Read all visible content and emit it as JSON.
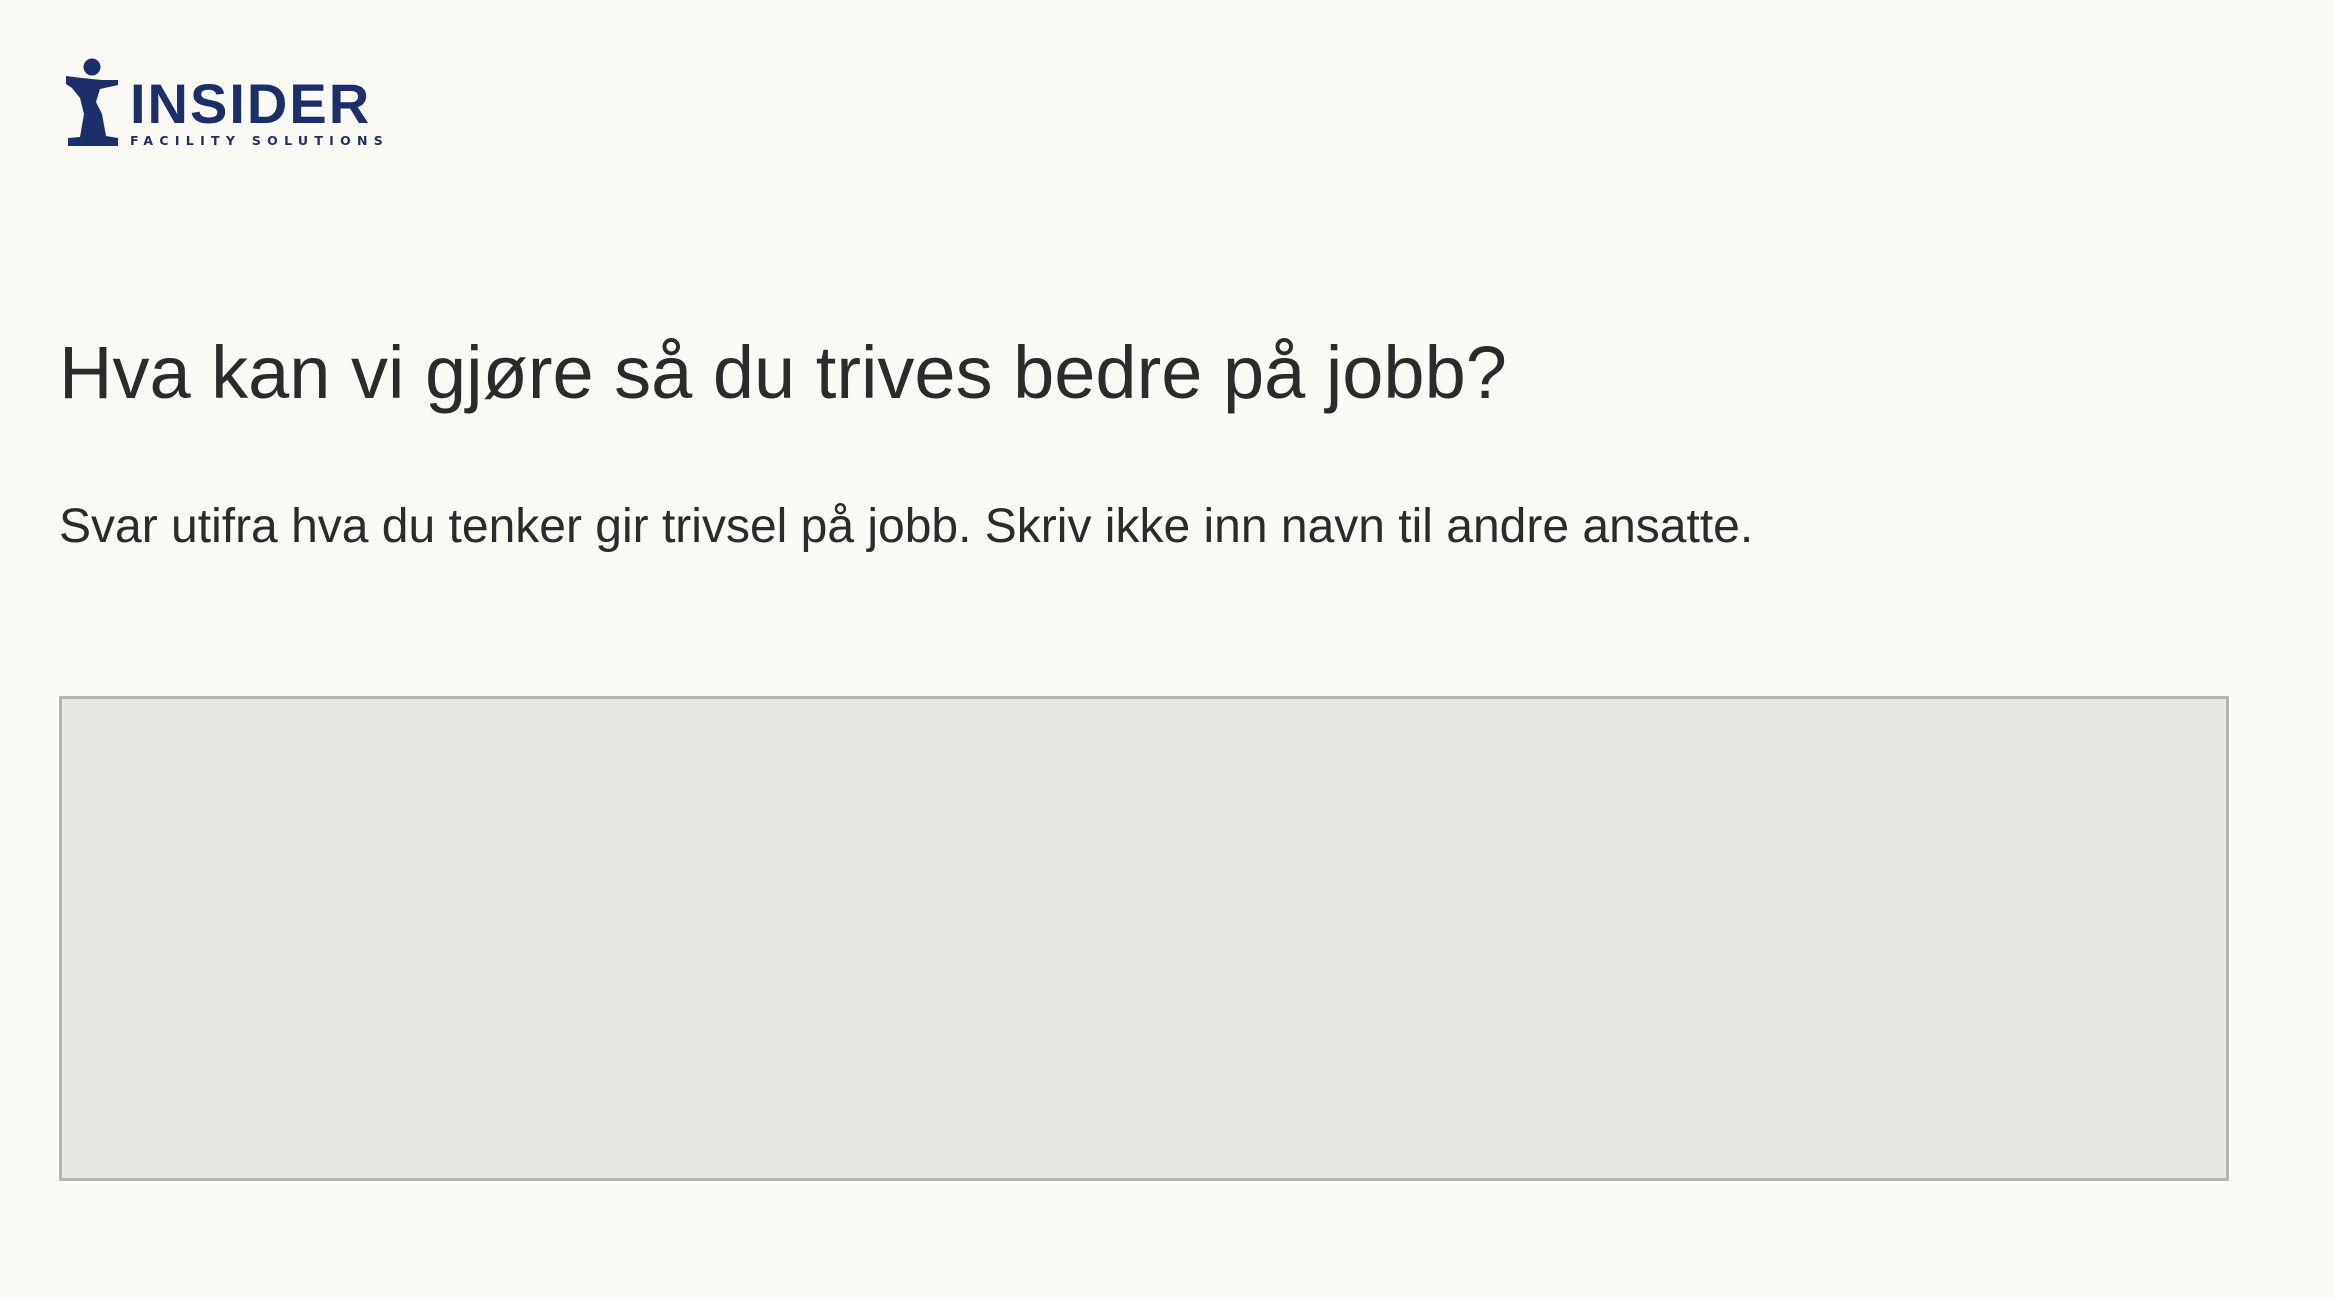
{
  "header": {
    "logo": {
      "name": "INSIDER",
      "tagline": "FACILITY SOLUTIONS",
      "icon": "person-figure-icon",
      "color": "#1d2f6b"
    }
  },
  "question": {
    "title": "Hva kan vi gjøre så du trives bedre på jobb?",
    "help_text": "Svar utifra hva du tenker gir trivsel på jobb. Skriv ikke inn navn til andre ansatte.",
    "answer": {
      "value": "",
      "placeholder": ""
    }
  },
  "colors": {
    "background": "#fbfaf5",
    "text": "#2b2b2b",
    "input_background": "#e7e6e0",
    "input_border": "#b5b4b0"
  }
}
